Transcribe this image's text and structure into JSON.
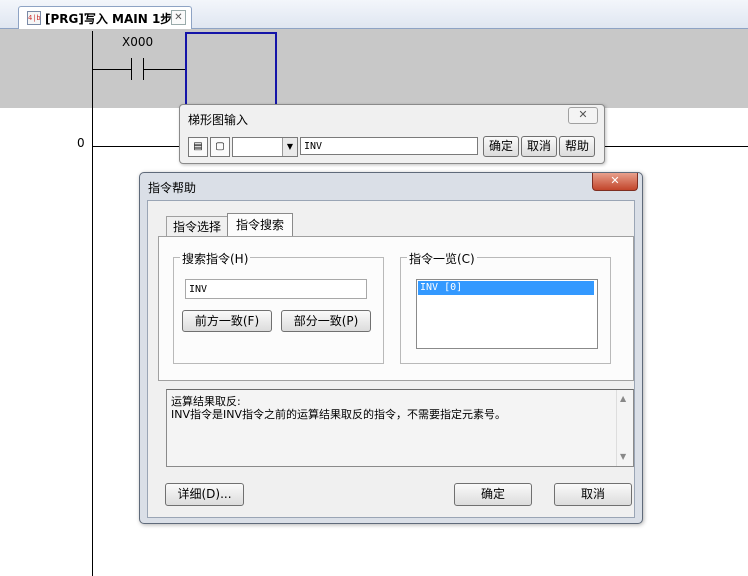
{
  "tab": {
    "icon": "ladder-program-icon",
    "icon_text": "4|b",
    "title": "[PRG]写入 MAIN 1步",
    "close": "✕"
  },
  "ladder": {
    "step_number": "0",
    "contact_device": "X000"
  },
  "ladder_input": {
    "title": "梯形图输入",
    "close": "✕",
    "combo_value": "",
    "combo_arrow": "▼",
    "input_value": "INV",
    "ok_label": "确定",
    "cancel_label": "取消",
    "help_label": "帮助"
  },
  "help_dialog": {
    "title": "指令帮助",
    "close": "✕",
    "tabs": [
      "指令选择",
      "指令搜索"
    ],
    "active_tab": "指令搜索",
    "search_group_label": "搜索指令(H)",
    "search_value": "INV",
    "prefix_match_label": "前方一致(F)",
    "partial_match_label": "部分一致(P)",
    "list_group_label": "指令一览(C)",
    "list_items": [
      "INV [0]"
    ],
    "description": [
      "运算结果取反:",
      "INV指令是INV指令之前的运算结果取反的指令，不需要指定元素号。"
    ],
    "scroll_up": "▲",
    "scroll_down": "▼",
    "detail_label": "详细(D)...",
    "ok_label": "确定",
    "cancel_label": "取消"
  }
}
